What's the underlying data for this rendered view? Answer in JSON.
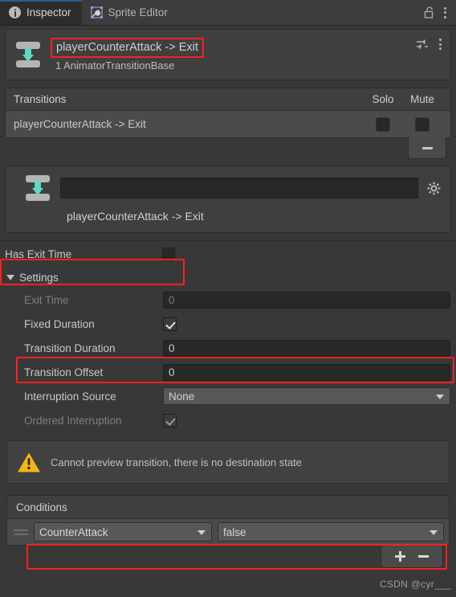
{
  "tabs": [
    {
      "label": "Inspector",
      "icon": "info-icon",
      "active": true
    },
    {
      "label": "Sprite Editor",
      "icon": "sprite-editor-icon",
      "active": false
    }
  ],
  "window_controls": {
    "lock": "lock-open-icon",
    "menu": "kebab-menu-icon"
  },
  "object_header": {
    "icon": "animator-transition-icon",
    "title": "playerCounterAttack -> Exit",
    "subtitle": "1 AnimatorTransitionBase",
    "preset_icon": "preset-icon",
    "menu_icon": "kebab-menu-icon"
  },
  "transitions": {
    "header": "Transitions",
    "col_solo": "Solo",
    "col_mute": "Mute",
    "rows": [
      {
        "name": "playerCounterAttack -> Exit",
        "solo": false,
        "mute": false
      }
    ],
    "remove_label": "−"
  },
  "transition_detail": {
    "name_value": "",
    "gear_icon": "gear-icon",
    "display_name": "playerCounterAttack -> Exit"
  },
  "properties": {
    "has_exit_time": {
      "label": "Has Exit Time",
      "checked": false
    },
    "settings_label": "Settings",
    "exit_time": {
      "label": "Exit Time",
      "value": "0",
      "disabled": true
    },
    "fixed_duration": {
      "label": "Fixed Duration",
      "checked": true
    },
    "transition_duration": {
      "label": "Transition Duration",
      "value": "0"
    },
    "transition_offset": {
      "label": "Transition Offset",
      "value": "0"
    },
    "interruption_source": {
      "label": "Interruption Source",
      "value": "None"
    },
    "ordered_interruption": {
      "label": "Ordered Interruption",
      "checked": true,
      "disabled": true
    }
  },
  "warning": {
    "icon": "warning-triangle-icon",
    "text": "Cannot preview transition, there is no destination state"
  },
  "conditions": {
    "header": "Conditions",
    "rows": [
      {
        "parameter": "CounterAttack",
        "value": "false"
      }
    ],
    "add_label": "+",
    "remove_label": "−"
  },
  "watermark": "CSDN @cyr___",
  "colors": {
    "highlight": "#ff2020",
    "accent_tab": "#2c5d87",
    "arrow_teal": "#5fd9c4",
    "warning_yellow": "#f2b712"
  }
}
